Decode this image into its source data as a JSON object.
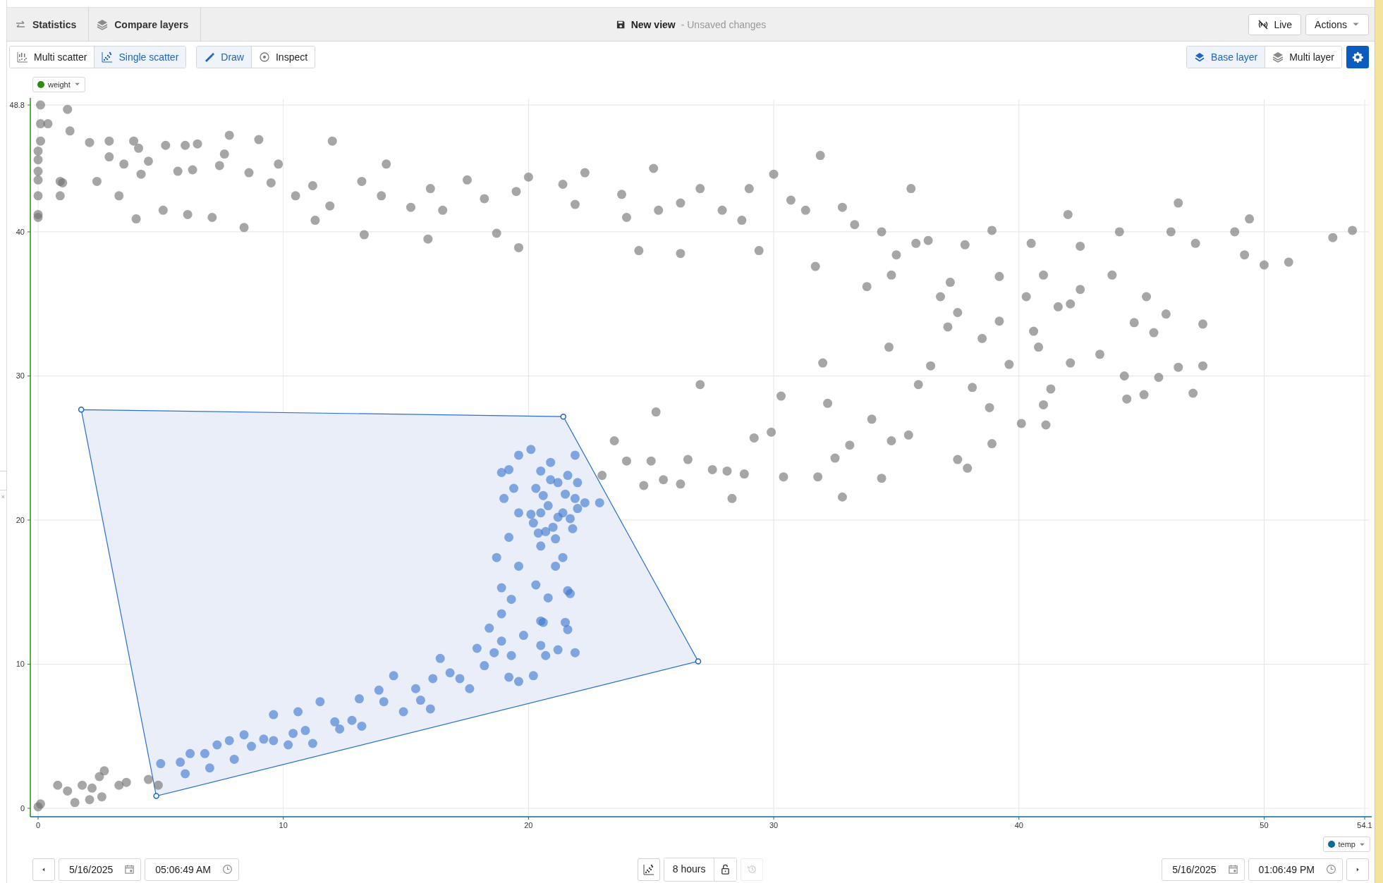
{
  "header": {
    "tabs": [
      {
        "label": "Statistics"
      },
      {
        "label": "Compare layers"
      }
    ],
    "title": "New view",
    "subtitle": "- Unsaved changes",
    "live_button": "Live",
    "actions_button": "Actions"
  },
  "toolbar": {
    "view_modes": [
      {
        "label": "Multi scatter",
        "selected": false
      },
      {
        "label": "Single scatter",
        "selected": true
      }
    ],
    "tools": [
      {
        "label": "Draw",
        "selected": true
      },
      {
        "label": "Inspect",
        "selected": false
      }
    ],
    "layers": [
      {
        "label": "Base layer",
        "selected": true
      },
      {
        "label": "Multi layer",
        "selected": false
      }
    ]
  },
  "side_handle": {
    "close": "×"
  },
  "chart": {
    "y_channel": {
      "label": "weight",
      "color": "#2e8b10"
    },
    "x_channel": {
      "label": "temp",
      "color": "#0b6b9b"
    },
    "chart_data": {
      "type": "scatter",
      "grid": true,
      "xlim": [
        0,
        54.1
      ],
      "ylim": [
        0,
        48.8
      ],
      "xticks": [
        0,
        10,
        20,
        30,
        40,
        50,
        54.1
      ],
      "yticks": [
        0,
        10,
        20,
        30,
        40,
        48.8
      ],
      "x": [
        0.1,
        0.1,
        0.4,
        1.2,
        1.3,
        0.1,
        0,
        0,
        0,
        0,
        0,
        0,
        0,
        0.9,
        1,
        0.9,
        2.1,
        2.9,
        3.9,
        4.1,
        3.5,
        2.9,
        2.4,
        3.3,
        4.2,
        4.5,
        5.2,
        5.7,
        6,
        6.5,
        6.3,
        7.8,
        7.6,
        7.4,
        8.6,
        9,
        9.5,
        9.8,
        4,
        5.1,
        6.1,
        7.1,
        8.4,
        10.5,
        11.2,
        11.3,
        11.9,
        12,
        13.2,
        13.3,
        14,
        14.2,
        15.2,
        16,
        15.9,
        16.5,
        17.5,
        18.2,
        18.7,
        19.5,
        19.6,
        20,
        21.4,
        21.9,
        22.3,
        23.8,
        24,
        24.5,
        25.1,
        25.3,
        26.2,
        26.2,
        27.9,
        27,
        28.7,
        29,
        29.4,
        30,
        30.7,
        31.3,
        31.7,
        31.9,
        32.8,
        33.3,
        33.8,
        34.4,
        35,
        35.6,
        35.8,
        36.3,
        37.2,
        37.8,
        38.9,
        39.2,
        40.3,
        40.5,
        41,
        41.6,
        42,
        42.1,
        42.5,
        43.3,
        43.8,
        44.1,
        44.7,
        45.2,
        46.2,
        46.5,
        47.2,
        47.5,
        48.8,
        49.2,
        49.4,
        50,
        51,
        52.8,
        53.6,
        45.5,
        46,
        40.8,
        39.6,
        38.5,
        38.8,
        38.1,
        23,
        23.5,
        24,
        24.7,
        25,
        25.2,
        25.5,
        26.2,
        26.5,
        27,
        27.5,
        28.1,
        28.3,
        28.8,
        29.2,
        29.9,
        30.3,
        30.4,
        31.8,
        32.2,
        32.8,
        32.5,
        33.1,
        34,
        34.4,
        34.8,
        35.5,
        35.9,
        36.4,
        37.1,
        37.5,
        37.5,
        37.9,
        38.9,
        40.1,
        41,
        41.1,
        41.3,
        42.1,
        44.3,
        44.4,
        45.1,
        45.7,
        46.5,
        47.1,
        47.5,
        42.5,
        40.6,
        39.2,
        36.8,
        34.8,
        34.7,
        32,
        0,
        0.1,
        0.8,
        1.2,
        1.5,
        2.2,
        2.1,
        2.5,
        2.7,
        3.3,
        3.6,
        4.5,
        4.9,
        2.6,
        1.8,
        5,
        5.8,
        6,
        6.2,
        6.8,
        7,
        7.3,
        7.8,
        8,
        8.4,
        8.7,
        9.2,
        9.6,
        9.6,
        10.2,
        10.4,
        10.6,
        10.9,
        11.2,
        11.5,
        12.1,
        12.3,
        12.8,
        13.1,
        13.2,
        13.9,
        14.1,
        14.5,
        14.9,
        15.4,
        15.6,
        16,
        16.1,
        16.4,
        16.8,
        17.2,
        17.6,
        17.9,
        18.2,
        18.4,
        18.6,
        18.9,
        19.2,
        19.3,
        19.6,
        19.8,
        20.2,
        20.5,
        18.9,
        19.3,
        18.9,
        19.6,
        18.7,
        19.2,
        19,
        18.9,
        19.4,
        19.6,
        20.2,
        20.5,
        20.3,
        20.5,
        20.6,
        20.8,
        21.1,
        21.4,
        21.6,
        21.6,
        21.7,
        21.9,
        21.5,
        21.2,
        20.7,
        20.1,
        20.3,
        20.5,
        20.8,
        20.9,
        21,
        21.2,
        21.4,
        21.6,
        21.8,
        21.9,
        21.9,
        22,
        22,
        20.1,
        22.3,
        21.1,
        20.7,
        19.6,
        19.2,
        20.5,
        21.5,
        20.9,
        22.9,
        21.2,
        20.6,
        21.7,
        20.4
      ],
      "series": [
        {
          "color": "#6f6f6f",
          "values": [
            48.8,
            47.5,
            47.5,
            48.5,
            47,
            46.3,
            45.6,
            45,
            44.2,
            43.6,
            42.5,
            41.2,
            41,
            43.5,
            43.4,
            42.5,
            46.2,
            46.3,
            46.3,
            45.8,
            44.7,
            45.2,
            43.5,
            42.5,
            44,
            44.9,
            46,
            44.2,
            46,
            46.1,
            44.3,
            46.7,
            45.4,
            44.6,
            44.1,
            46.4,
            43.4,
            44.7,
            40.9,
            41.5,
            41.2,
            41,
            40.3,
            42.5,
            43.2,
            40.8,
            41.8,
            46.3,
            43.5,
            39.8,
            42.5,
            44.7,
            41.7,
            43,
            39.5,
            41.5,
            43.6,
            42.3,
            39.9,
            42.8,
            38.9,
            43.8,
            43.3,
            41.9,
            44.1,
            42.6,
            41,
            38.7,
            44.4,
            41.5,
            42,
            38.5,
            41.5,
            43,
            40.8,
            43,
            38.7,
            44,
            42.2,
            41.5,
            37.6,
            45.3,
            41.7,
            40.5,
            36.2,
            40,
            38.4,
            43,
            39.2,
            39.4,
            36.5,
            39.1,
            40.1,
            36.9,
            35.5,
            39.2,
            37,
            34.8,
            41.2,
            35,
            39,
            31.5,
            37,
            40,
            33.7,
            35.5,
            40,
            42,
            39.2,
            33.6,
            40,
            38.4,
            40.9,
            37.7,
            37.9,
            39.6,
            40.1,
            33,
            34.3,
            32,
            30.8,
            32.6,
            27.8,
            29.2,
            23.1,
            25.5,
            24.1,
            22.4,
            24.1,
            27.5,
            22.8,
            22.5,
            24.2,
            29.4,
            23.5,
            23.4,
            21.5,
            23.2,
            25.7,
            26.1,
            28.6,
            23,
            23,
            28.1,
            21.6,
            24.3,
            25.2,
            27,
            22.9,
            25.5,
            25.9,
            29.4,
            30.7,
            33.4,
            34.4,
            24.2,
            23.6,
            25.3,
            26.7,
            28,
            26.6,
            29.1,
            30.9,
            30,
            28.4,
            28.7,
            29.9,
            30.6,
            28.8,
            30.7,
            36,
            33.1,
            33.8,
            35.5,
            37,
            32,
            30.9,
            0.1,
            0.3,
            1.6,
            1.2,
            0.4,
            1.4,
            0.6,
            2.2,
            2.6,
            1.6,
            1.8,
            2,
            1.6,
            0.8,
            1.6,
            null,
            null,
            null,
            null,
            null,
            null,
            null,
            null,
            null,
            null,
            null,
            null,
            null,
            null,
            null,
            null,
            null,
            null,
            null,
            null,
            null,
            null,
            null,
            null,
            null,
            null,
            null,
            null,
            null,
            null,
            null,
            null,
            null,
            null,
            null,
            null,
            null,
            null,
            null,
            null,
            null,
            null,
            null,
            null,
            null,
            null,
            null,
            null,
            null,
            null,
            null,
            null,
            null,
            null,
            null,
            null,
            null,
            null,
            null,
            null,
            null,
            null,
            null,
            null,
            null,
            null,
            null,
            null,
            null,
            null,
            null,
            null,
            null,
            null,
            null,
            null,
            null,
            null,
            null,
            null,
            null,
            null,
            null,
            null,
            null,
            null,
            null,
            null,
            null,
            null,
            null,
            null,
            null,
            null,
            null,
            null,
            null,
            null,
            null,
            null,
            null
          ]
        },
        {
          "color": "#3b78d1",
          "values": [
            null,
            null,
            null,
            null,
            null,
            null,
            null,
            null,
            null,
            null,
            null,
            null,
            null,
            null,
            null,
            null,
            null,
            null,
            null,
            null,
            null,
            null,
            null,
            null,
            null,
            null,
            null,
            null,
            null,
            null,
            null,
            null,
            null,
            null,
            null,
            null,
            null,
            null,
            null,
            null,
            null,
            null,
            null,
            null,
            null,
            null,
            null,
            null,
            null,
            null,
            null,
            null,
            null,
            null,
            null,
            null,
            null,
            null,
            null,
            null,
            null,
            null,
            null,
            null,
            null,
            null,
            null,
            null,
            null,
            null,
            null,
            null,
            null,
            null,
            null,
            null,
            null,
            null,
            null,
            null,
            null,
            null,
            null,
            null,
            null,
            null,
            null,
            null,
            null,
            null,
            null,
            null,
            null,
            null,
            null,
            null,
            null,
            null,
            null,
            null,
            null,
            null,
            null,
            null,
            null,
            null,
            null,
            null,
            null,
            null,
            null,
            null,
            null,
            null,
            null,
            null,
            null,
            null,
            null,
            null,
            null,
            null,
            null,
            null,
            null,
            null,
            null,
            null,
            null,
            null,
            null,
            null,
            null,
            null,
            null,
            null,
            null,
            null,
            null,
            null,
            null,
            null,
            null,
            null,
            null,
            null,
            null,
            null,
            null,
            null,
            null,
            null,
            null,
            null,
            null,
            null,
            null,
            null,
            null,
            null,
            null,
            null,
            null,
            null,
            null,
            null,
            null,
            null,
            null,
            null,
            null,
            null,
            null,
            null,
            null,
            null,
            null,
            null,
            null,
            null,
            null,
            null,
            null,
            null,
            null,
            null,
            null,
            null,
            null,
            null,
            null,
            null,
            3.1,
            3.2,
            2.4,
            3.8,
            3.8,
            2.8,
            4.4,
            4.7,
            3.4,
            5.1,
            4.3,
            4.8,
            4.7,
            6.5,
            4.4,
            5.2,
            6.7,
            5.4,
            4.5,
            7.4,
            6,
            5.5,
            6.1,
            7.6,
            5.7,
            8.2,
            7.4,
            9.2,
            6.7,
            8.3,
            7.5,
            6.9,
            9,
            10.4,
            9.4,
            9,
            8.3,
            11.1,
            9.9,
            12.5,
            10.8,
            11.6,
            9.1,
            10.6,
            8.8,
            12,
            9.2,
            11.3,
            13.5,
            14.5,
            15.3,
            16.8,
            17.4,
            18.8,
            21.5,
            23.3,
            22.2,
            24.5,
            19.8,
            18.2,
            15.5,
            13,
            12.9,
            14.6,
            16.8,
            17.4,
            15.1,
            12.4,
            14.9,
            10.8,
            12.9,
            11,
            10.6,
            20.4,
            22.2,
            23.4,
            21,
            24,
            19.5,
            22.6,
            20.5,
            23.1,
            19.4,
            21.5,
            24.5,
            20.8,
            22.6,
            24.9,
            21.2,
            18.7,
            19.2,
            20.5,
            23.5,
            20.5,
            21.8,
            22.8,
            21.2,
            20.2,
            21.7,
            20.1,
            19.1
          ]
        }
      ]
    }
  },
  "time_bar": {
    "start_date": "5/16/2025",
    "start_time": "05:06:49 AM",
    "duration": "8 hours",
    "end_date": "5/16/2025",
    "end_time": "01:06:49 PM"
  }
}
